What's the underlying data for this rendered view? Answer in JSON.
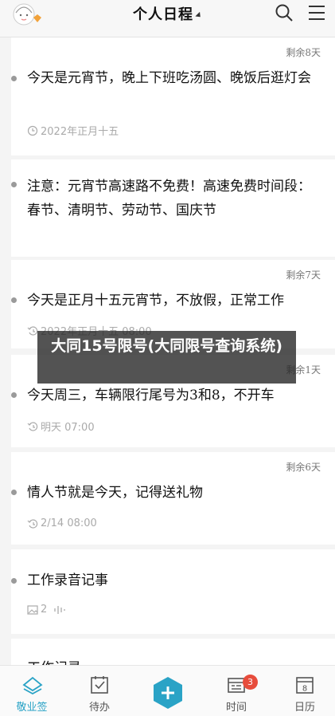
{
  "header": {
    "title": "个人日程"
  },
  "entries": [
    {
      "remain": "剩余8天",
      "text": "今天是元宵节，晚上下班吃汤圆、晚饭后逛灯会",
      "meta": "2022年正月十五"
    },
    {
      "remain": "",
      "text": "注意：元宵节高速路不免费！高速免费时间段：春节、清明节、劳动节、国庆节",
      "meta": ""
    },
    {
      "remain": "剩余7天",
      "text": "今天是正月十五元宵节，不放假，正常工作",
      "meta": "2022年正月十五  08:00"
    },
    {
      "remain": "剩余1天",
      "text": "今天周三，车辆限行尾号为3和8，不开车",
      "meta": "明天  07:00"
    },
    {
      "remain": "剩余6天",
      "text": "情人节就是今天，记得送礼物",
      "meta": "2/14  08:00"
    },
    {
      "remain": "",
      "text": "工作录音记事",
      "meta": "2"
    },
    {
      "remain": "",
      "text": "工作记录",
      "meta": ""
    }
  ],
  "overlay": {
    "banner": "大同15号限号(大同限号查询系统)"
  },
  "tabs": [
    {
      "label": "敬业签"
    },
    {
      "label": "待办"
    },
    {
      "label": "时间"
    },
    {
      "label": "日历"
    }
  ],
  "badge": {
    "count": "3"
  },
  "colors": {
    "accent": "#2aa3c6",
    "badge": "#e74c3c"
  }
}
